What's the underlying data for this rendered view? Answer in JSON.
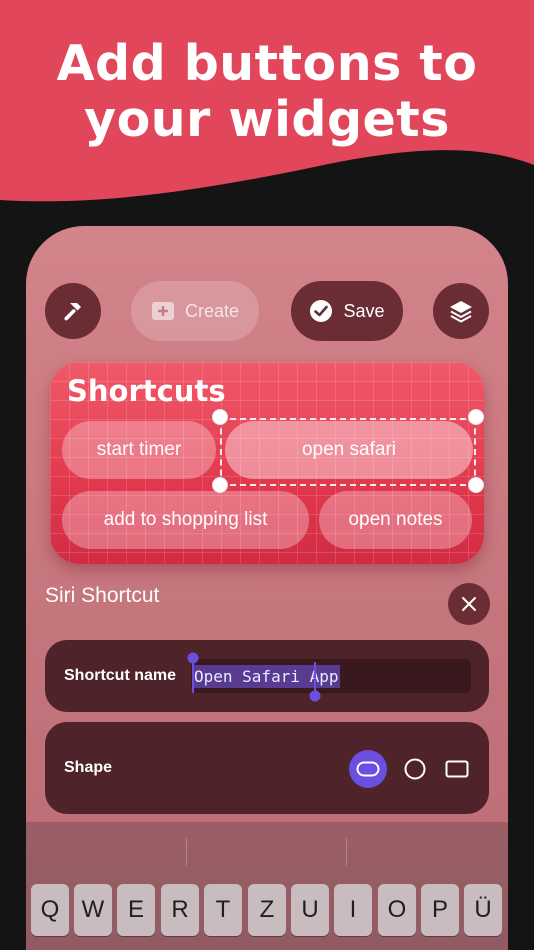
{
  "header": {
    "title_line1": "Add buttons to",
    "title_line2": "your widgets",
    "background_color": "#e2465a"
  },
  "toolbar": {
    "edit_icon": "hammer-icon",
    "create_label": "Create",
    "create_icon": "plus-square-icon",
    "save_label": "Save",
    "save_icon": "checkmark-circle-icon",
    "layers_icon": "layers-icon"
  },
  "widget": {
    "title": "Shortcuts",
    "buttons": [
      {
        "label": "start timer"
      },
      {
        "label": "open safari",
        "selected": true
      },
      {
        "label": "add to shopping list"
      },
      {
        "label": "open notes"
      }
    ],
    "accent_color": "#e2384e"
  },
  "siri_section": {
    "title": "Siri Shortcut",
    "close_icon": "close-icon",
    "shortcut_name_label": "Shortcut name",
    "shortcut_name_value": "Open Safari App",
    "shape_label": "Shape",
    "shape_options": [
      {
        "name": "pill",
        "selected": true
      },
      {
        "name": "circle",
        "selected": false
      },
      {
        "name": "rectangle",
        "selected": false
      }
    ],
    "selection_color": "#6a4fe0"
  },
  "keyboard": {
    "row1": [
      "Q",
      "W",
      "E",
      "R",
      "T",
      "Z",
      "U",
      "I",
      "O",
      "P",
      "Ü"
    ]
  }
}
